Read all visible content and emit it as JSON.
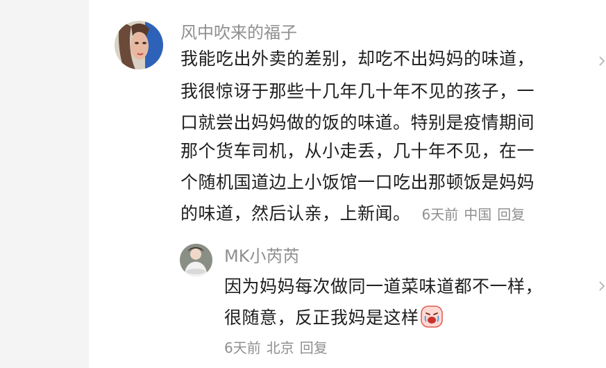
{
  "comment": {
    "username": "风中吹来的福子",
    "lines": [
      "我能吃出外卖的差别，却吃不出妈妈的味道，",
      "我很惊讶于那些十几年几十年不见的孩子，一",
      "口就尝出妈妈做的饭的味道。特别是疫情期间",
      "那个货车司机，从小走丢，几十年不见，在一",
      "个随机国道边上小饭馆一口吃出那顿饭是妈妈",
      "的味道，然后认亲，上新闻。"
    ],
    "time": "6天前",
    "location": "中国",
    "reply_label": "回复"
  },
  "reply": {
    "username": "MK小芮芮",
    "lines": [
      "因为妈妈每次做同一道菜味道都不一样，",
      "很随意，反正我妈是这样"
    ],
    "emoji": "crying-face-emoji",
    "time": "6天前",
    "location": "北京",
    "reply_label": "回复"
  },
  "colors": {
    "text": "#1e1e1e",
    "meta": "#8f8f8f",
    "background": "#ffffff",
    "left_strip": "#f4f4f4"
  }
}
